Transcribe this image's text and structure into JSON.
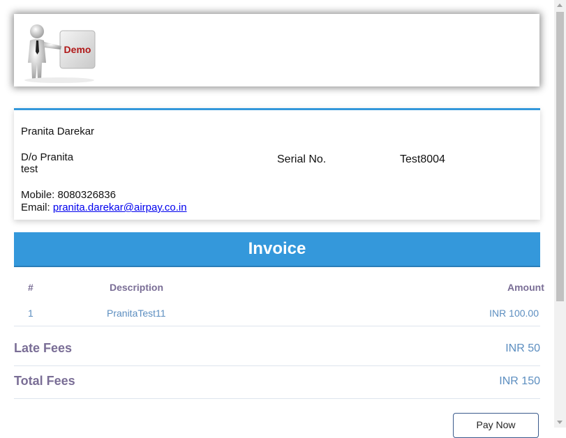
{
  "header": {
    "logo_text": "Demo"
  },
  "customer": {
    "name": "Pranita Darekar",
    "parent_line1": "D/o Pranita",
    "parent_line2": "test",
    "serial_label": "Serial No.",
    "serial_value": "Test8004",
    "mobile_label": "Mobile:",
    "mobile": "8080326836",
    "email_label": "Email:",
    "email": "pranita.darekar@airpay.co.in"
  },
  "invoice": {
    "title": "Invoice",
    "columns": {
      "num": "#",
      "description": "Description",
      "amount": "Amount"
    },
    "rows": [
      {
        "num": "1",
        "description": "PranitaTest11",
        "amount": "INR 100.00"
      }
    ]
  },
  "fees": {
    "late_label": "Late Fees",
    "late_value": "INR 50",
    "total_label": "Total Fees",
    "total_value": "INR 150"
  },
  "actions": {
    "pay_label": "Pay Now"
  },
  "colors": {
    "accent": "#3498db",
    "label": "#7a6e96",
    "value": "#5c8ec0"
  }
}
